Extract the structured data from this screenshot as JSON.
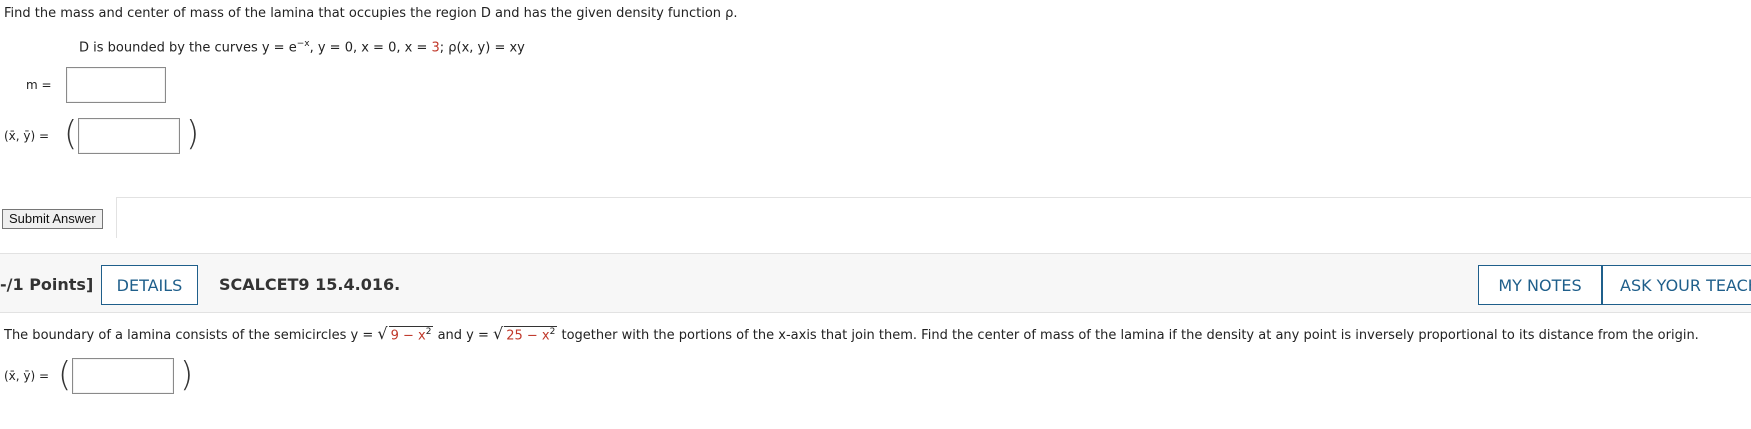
{
  "q1": {
    "prompt": "Find the mass and center of mass of the lamina that occupies the region D and has the given density function ρ.",
    "region_prefix": "D is bounded by the curves y = e",
    "region_exp": "−x",
    "region_mid": ", y = 0, x = 0, x = ",
    "region_val": "3",
    "region_suffix": "; ρ(x, y) = xy",
    "mass_label": "m =",
    "cm_label": "(x̄, ȳ) =",
    "submit_label": "Submit Answer"
  },
  "q2": {
    "points": "-/1 Points]",
    "details_label": "DETAILS",
    "code": "SCALCET9 15.4.016.",
    "notes_label": "MY NOTES",
    "ask_label": "ASK YOUR TEACH",
    "text_a": "The boundary of a lamina consists of the semicircles y =",
    "rad1": "9 − x",
    "text_b": "and y =",
    "rad2": "25 − x",
    "text_c": "together with the portions of the x-axis that join them. Find the center of mass of the lamina if the density at any point is inversely proportional to its distance from the origin.",
    "cm_label": "(x̄, ȳ) ="
  },
  "colors": {
    "accent": "#1f5f8b",
    "given_value": "#c0392b"
  }
}
